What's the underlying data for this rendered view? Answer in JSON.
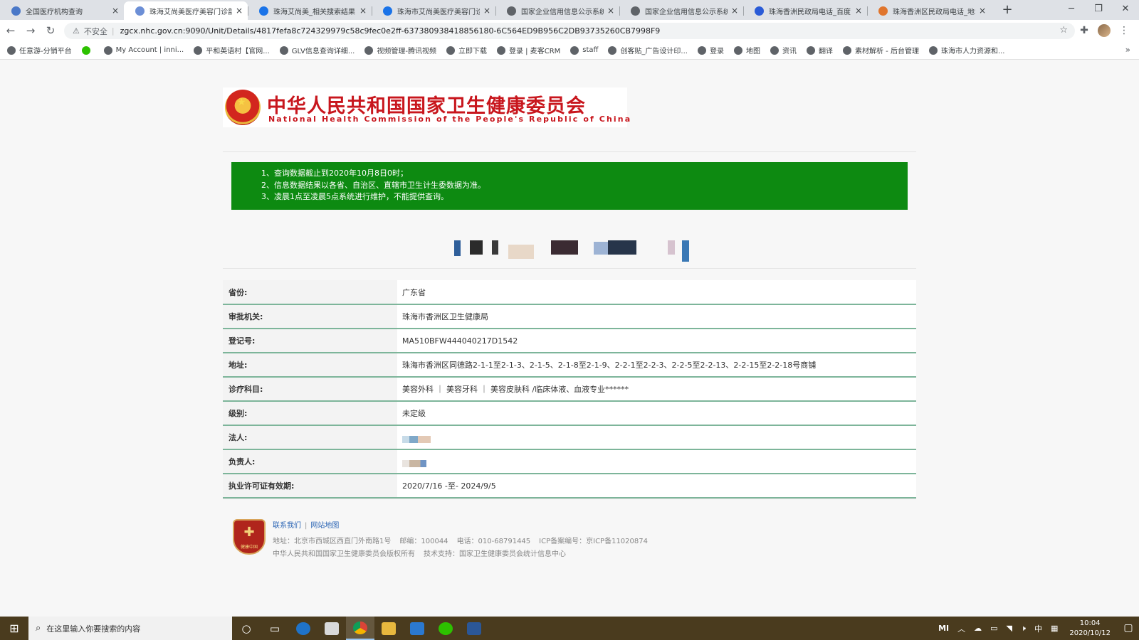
{
  "browser": {
    "tabs": [
      {
        "title": "全国医疗机构查询",
        "icon_color": "#4a78c8",
        "active": false
      },
      {
        "title": "珠海艾尚美医疗美容门诊部",
        "icon_color": "#6c8fd6",
        "active": true
      },
      {
        "title": "珠海艾尚美_相关搜索结果",
        "icon_color": "#1a73e8",
        "active": false
      },
      {
        "title": "珠海市艾尚美医疗美容门诊",
        "icon_color": "#1a73e8",
        "active": false
      },
      {
        "title": "国家企业信用信息公示系统",
        "icon_color": "#5f6368",
        "active": false
      },
      {
        "title": "国家企业信用信息公示系统",
        "icon_color": "#5f6368",
        "active": false
      },
      {
        "title": "珠海香洲民政局电话_百度",
        "icon_color": "#2a5bd7",
        "active": false
      },
      {
        "title": "珠海香洲区民政局电话_地址",
        "icon_color": "#e0752d",
        "active": false
      }
    ],
    "new_tab": "+",
    "window_controls": {
      "minimize": "─",
      "restore": "❐",
      "close": "✕"
    },
    "nav": {
      "back": "←",
      "forward": "→",
      "reload": "↻"
    },
    "address": {
      "warning_icon": "⚠",
      "insecure_label": "不安全",
      "url": "zgcx.nhc.gov.cn:9090/Unit/Details/4817fefa8c724329979c58c9fec0e2ff-637380938418856180-6C564ED9B956C2DB93735260CB7998F9"
    },
    "bookmark_star": "☆",
    "extensions_icon": "✚",
    "menu_icon": "⋮",
    "bookmarks": [
      "任意游-分销平台",
      "",
      "My Account | inni...",
      "平和英语村【官网...",
      "GLV信息查询详细...",
      "视频管理-腾讯视频",
      "立即下载",
      "登录 | 麦客CRM",
      "staff",
      "创客贴_广告设计印...",
      "登录",
      "地图",
      "资讯",
      "翻译",
      "素材解析 - 后台管理",
      "珠海市人力资源和..."
    ],
    "bookmarks_more": "»"
  },
  "site": {
    "logo_cn": "中华人民共和国国家卫生健康委员会",
    "logo_en": "National Health Commission of the People's Republic of China",
    "notice": [
      "1、查询数据截止到2020年10月8日0时；",
      "2、信息数据结果以各省、自治区、直辖市卫生计生委数据为准。",
      "3、凌晨1点至凌晨5点系统进行维护，不能提供查询。"
    ],
    "details": [
      {
        "label": "省份:",
        "value": "广东省"
      },
      {
        "label": "审批机关:",
        "value": "珠海市香洲区卫生健康局"
      },
      {
        "label": "登记号:",
        "value": "MA510BFW444040217D1542"
      },
      {
        "label": "地址:",
        "value": "珠海市香洲区同德路2-1-1至2-1-3、2-1-5、2-1-8至2-1-9、2-2-1至2-2-3、2-2-5至2-2-13、2-2-15至2-2-18号商铺"
      },
      {
        "label": "诊疗科目:",
        "value": "美容外科 ｜ 美容牙科 ｜ 美容皮肤科 /临床体液、血液专业******"
      },
      {
        "label": "级别:",
        "value": "未定级"
      },
      {
        "label": "法人:",
        "value": ""
      },
      {
        "label": "负责人:",
        "value": ""
      },
      {
        "label": "执业许可证有效期:",
        "value": "2020/7/16 -至- 2024/9/5"
      }
    ],
    "footer": {
      "emblem_text": "健康中国",
      "links": [
        "联系我们",
        "网站地图"
      ],
      "line1": [
        "地址：北京市西城区西直门外南路1号",
        "邮编：100044",
        "电话：010-68791445",
        "ICP备案编号：京ICP备11020874"
      ],
      "line2": [
        "中华人民共和国国家卫生健康委员会版权所有",
        "技术支持：国家卫生健康委员会统计信息中心"
      ]
    }
  },
  "taskbar": {
    "start_icon": "⊞",
    "search_placeholder": "在这里输入你要搜索的内容",
    "apps": [
      "cortana-icon",
      "task-view-icon",
      "edge-icon",
      "store-icon",
      "chrome-icon",
      "file-explorer-icon",
      "mail-icon",
      "wechat-icon",
      "word-icon"
    ],
    "tray": {
      "mi": "MI",
      "ime": "中",
      "time": "10:04",
      "date": "2020/10/12"
    }
  },
  "colors": {
    "notice_bg": "#0d8a11",
    "brand_red": "#c8161d",
    "table_border": "#7db59a",
    "taskbar": "#4a3b1e"
  }
}
